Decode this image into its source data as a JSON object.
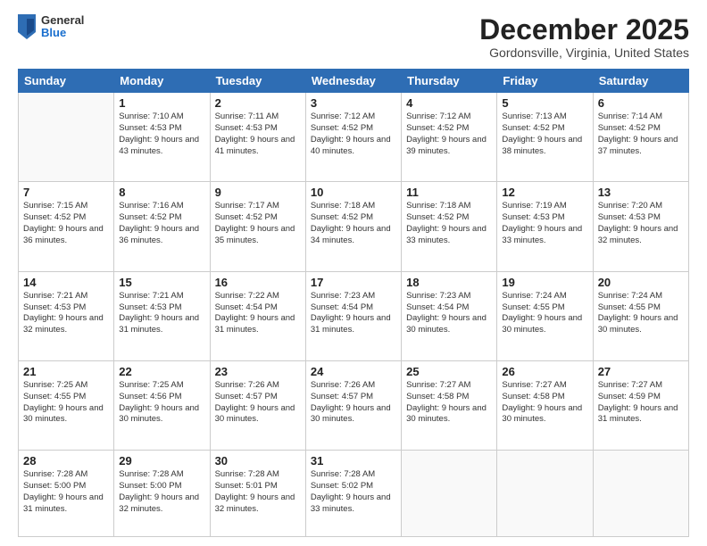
{
  "logo": {
    "general": "General",
    "blue": "Blue"
  },
  "title": "December 2025",
  "location": "Gordonsville, Virginia, United States",
  "days_header": [
    "Sunday",
    "Monday",
    "Tuesday",
    "Wednesday",
    "Thursday",
    "Friday",
    "Saturday"
  ],
  "weeks": [
    [
      {
        "day": "",
        "sunrise": "",
        "sunset": "",
        "daylight": ""
      },
      {
        "day": "1",
        "sunrise": "Sunrise: 7:10 AM",
        "sunset": "Sunset: 4:53 PM",
        "daylight": "Daylight: 9 hours and 43 minutes."
      },
      {
        "day": "2",
        "sunrise": "Sunrise: 7:11 AM",
        "sunset": "Sunset: 4:53 PM",
        "daylight": "Daylight: 9 hours and 41 minutes."
      },
      {
        "day": "3",
        "sunrise": "Sunrise: 7:12 AM",
        "sunset": "Sunset: 4:52 PM",
        "daylight": "Daylight: 9 hours and 40 minutes."
      },
      {
        "day": "4",
        "sunrise": "Sunrise: 7:12 AM",
        "sunset": "Sunset: 4:52 PM",
        "daylight": "Daylight: 9 hours and 39 minutes."
      },
      {
        "day": "5",
        "sunrise": "Sunrise: 7:13 AM",
        "sunset": "Sunset: 4:52 PM",
        "daylight": "Daylight: 9 hours and 38 minutes."
      },
      {
        "day": "6",
        "sunrise": "Sunrise: 7:14 AM",
        "sunset": "Sunset: 4:52 PM",
        "daylight": "Daylight: 9 hours and 37 minutes."
      }
    ],
    [
      {
        "day": "7",
        "sunrise": "Sunrise: 7:15 AM",
        "sunset": "Sunset: 4:52 PM",
        "daylight": "Daylight: 9 hours and 36 minutes."
      },
      {
        "day": "8",
        "sunrise": "Sunrise: 7:16 AM",
        "sunset": "Sunset: 4:52 PM",
        "daylight": "Daylight: 9 hours and 36 minutes."
      },
      {
        "day": "9",
        "sunrise": "Sunrise: 7:17 AM",
        "sunset": "Sunset: 4:52 PM",
        "daylight": "Daylight: 9 hours and 35 minutes."
      },
      {
        "day": "10",
        "sunrise": "Sunrise: 7:18 AM",
        "sunset": "Sunset: 4:52 PM",
        "daylight": "Daylight: 9 hours and 34 minutes."
      },
      {
        "day": "11",
        "sunrise": "Sunrise: 7:18 AM",
        "sunset": "Sunset: 4:52 PM",
        "daylight": "Daylight: 9 hours and 33 minutes."
      },
      {
        "day": "12",
        "sunrise": "Sunrise: 7:19 AM",
        "sunset": "Sunset: 4:53 PM",
        "daylight": "Daylight: 9 hours and 33 minutes."
      },
      {
        "day": "13",
        "sunrise": "Sunrise: 7:20 AM",
        "sunset": "Sunset: 4:53 PM",
        "daylight": "Daylight: 9 hours and 32 minutes."
      }
    ],
    [
      {
        "day": "14",
        "sunrise": "Sunrise: 7:21 AM",
        "sunset": "Sunset: 4:53 PM",
        "daylight": "Daylight: 9 hours and 32 minutes."
      },
      {
        "day": "15",
        "sunrise": "Sunrise: 7:21 AM",
        "sunset": "Sunset: 4:53 PM",
        "daylight": "Daylight: 9 hours and 31 minutes."
      },
      {
        "day": "16",
        "sunrise": "Sunrise: 7:22 AM",
        "sunset": "Sunset: 4:54 PM",
        "daylight": "Daylight: 9 hours and 31 minutes."
      },
      {
        "day": "17",
        "sunrise": "Sunrise: 7:23 AM",
        "sunset": "Sunset: 4:54 PM",
        "daylight": "Daylight: 9 hours and 31 minutes."
      },
      {
        "day": "18",
        "sunrise": "Sunrise: 7:23 AM",
        "sunset": "Sunset: 4:54 PM",
        "daylight": "Daylight: 9 hours and 30 minutes."
      },
      {
        "day": "19",
        "sunrise": "Sunrise: 7:24 AM",
        "sunset": "Sunset: 4:55 PM",
        "daylight": "Daylight: 9 hours and 30 minutes."
      },
      {
        "day": "20",
        "sunrise": "Sunrise: 7:24 AM",
        "sunset": "Sunset: 4:55 PM",
        "daylight": "Daylight: 9 hours and 30 minutes."
      }
    ],
    [
      {
        "day": "21",
        "sunrise": "Sunrise: 7:25 AM",
        "sunset": "Sunset: 4:55 PM",
        "daylight": "Daylight: 9 hours and 30 minutes."
      },
      {
        "day": "22",
        "sunrise": "Sunrise: 7:25 AM",
        "sunset": "Sunset: 4:56 PM",
        "daylight": "Daylight: 9 hours and 30 minutes."
      },
      {
        "day": "23",
        "sunrise": "Sunrise: 7:26 AM",
        "sunset": "Sunset: 4:57 PM",
        "daylight": "Daylight: 9 hours and 30 minutes."
      },
      {
        "day": "24",
        "sunrise": "Sunrise: 7:26 AM",
        "sunset": "Sunset: 4:57 PM",
        "daylight": "Daylight: 9 hours and 30 minutes."
      },
      {
        "day": "25",
        "sunrise": "Sunrise: 7:27 AM",
        "sunset": "Sunset: 4:58 PM",
        "daylight": "Daylight: 9 hours and 30 minutes."
      },
      {
        "day": "26",
        "sunrise": "Sunrise: 7:27 AM",
        "sunset": "Sunset: 4:58 PM",
        "daylight": "Daylight: 9 hours and 30 minutes."
      },
      {
        "day": "27",
        "sunrise": "Sunrise: 7:27 AM",
        "sunset": "Sunset: 4:59 PM",
        "daylight": "Daylight: 9 hours and 31 minutes."
      }
    ],
    [
      {
        "day": "28",
        "sunrise": "Sunrise: 7:28 AM",
        "sunset": "Sunset: 5:00 PM",
        "daylight": "Daylight: 9 hours and 31 minutes."
      },
      {
        "day": "29",
        "sunrise": "Sunrise: 7:28 AM",
        "sunset": "Sunset: 5:00 PM",
        "daylight": "Daylight: 9 hours and 32 minutes."
      },
      {
        "day": "30",
        "sunrise": "Sunrise: 7:28 AM",
        "sunset": "Sunset: 5:01 PM",
        "daylight": "Daylight: 9 hours and 32 minutes."
      },
      {
        "day": "31",
        "sunrise": "Sunrise: 7:28 AM",
        "sunset": "Sunset: 5:02 PM",
        "daylight": "Daylight: 9 hours and 33 minutes."
      },
      {
        "day": "",
        "sunrise": "",
        "sunset": "",
        "daylight": ""
      },
      {
        "day": "",
        "sunrise": "",
        "sunset": "",
        "daylight": ""
      },
      {
        "day": "",
        "sunrise": "",
        "sunset": "",
        "daylight": ""
      }
    ]
  ]
}
